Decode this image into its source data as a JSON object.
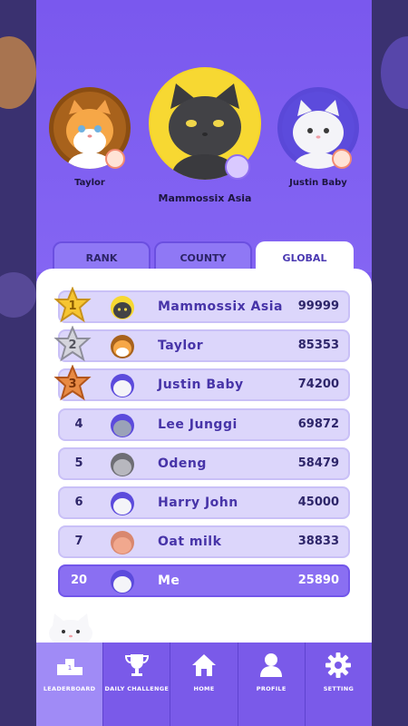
{
  "podium": {
    "first": {
      "name": "Mammossix Asia"
    },
    "second": {
      "name": "Taylor"
    },
    "third": {
      "name": "Justin Baby"
    }
  },
  "tabs": [
    {
      "label": "RANK"
    },
    {
      "label": "COUNTY"
    },
    {
      "label": "GLOBAL",
      "active": true
    }
  ],
  "leaderboard": [
    {
      "rank": "1",
      "name": "Mammossix Asia",
      "score": "99999",
      "medal": "gold"
    },
    {
      "rank": "2",
      "name": "Taylor",
      "score": "85353",
      "medal": "silver"
    },
    {
      "rank": "3",
      "name": "Justin Baby",
      "score": "74200",
      "medal": "bronze"
    },
    {
      "rank": "4",
      "name": "Lee Junggi",
      "score": "69872"
    },
    {
      "rank": "5",
      "name": "Odeng",
      "score": "58479"
    },
    {
      "rank": "6",
      "name": "Harry John",
      "score": "45000"
    },
    {
      "rank": "7",
      "name": "Oat milk",
      "score": "38833"
    },
    {
      "rank": "20",
      "name": "Me",
      "score": "25890",
      "is_me": true
    }
  ],
  "nav": [
    {
      "label": "LEADERBOARD",
      "icon": "podium-icon",
      "active": true
    },
    {
      "label": "DAILY CHALLENGE",
      "icon": "trophy-icon"
    },
    {
      "label": "HOME",
      "icon": "home-icon"
    },
    {
      "label": "PROFILE",
      "icon": "profile-icon"
    },
    {
      "label": "SETTING",
      "icon": "gear-icon"
    }
  ],
  "colors": {
    "primary": "#7e5cef",
    "gold": "#f6c532",
    "silver": "#c9c9d2",
    "bronze": "#e07b3c",
    "row": "#dcd6fb",
    "me_row": "#8a6ff2"
  }
}
